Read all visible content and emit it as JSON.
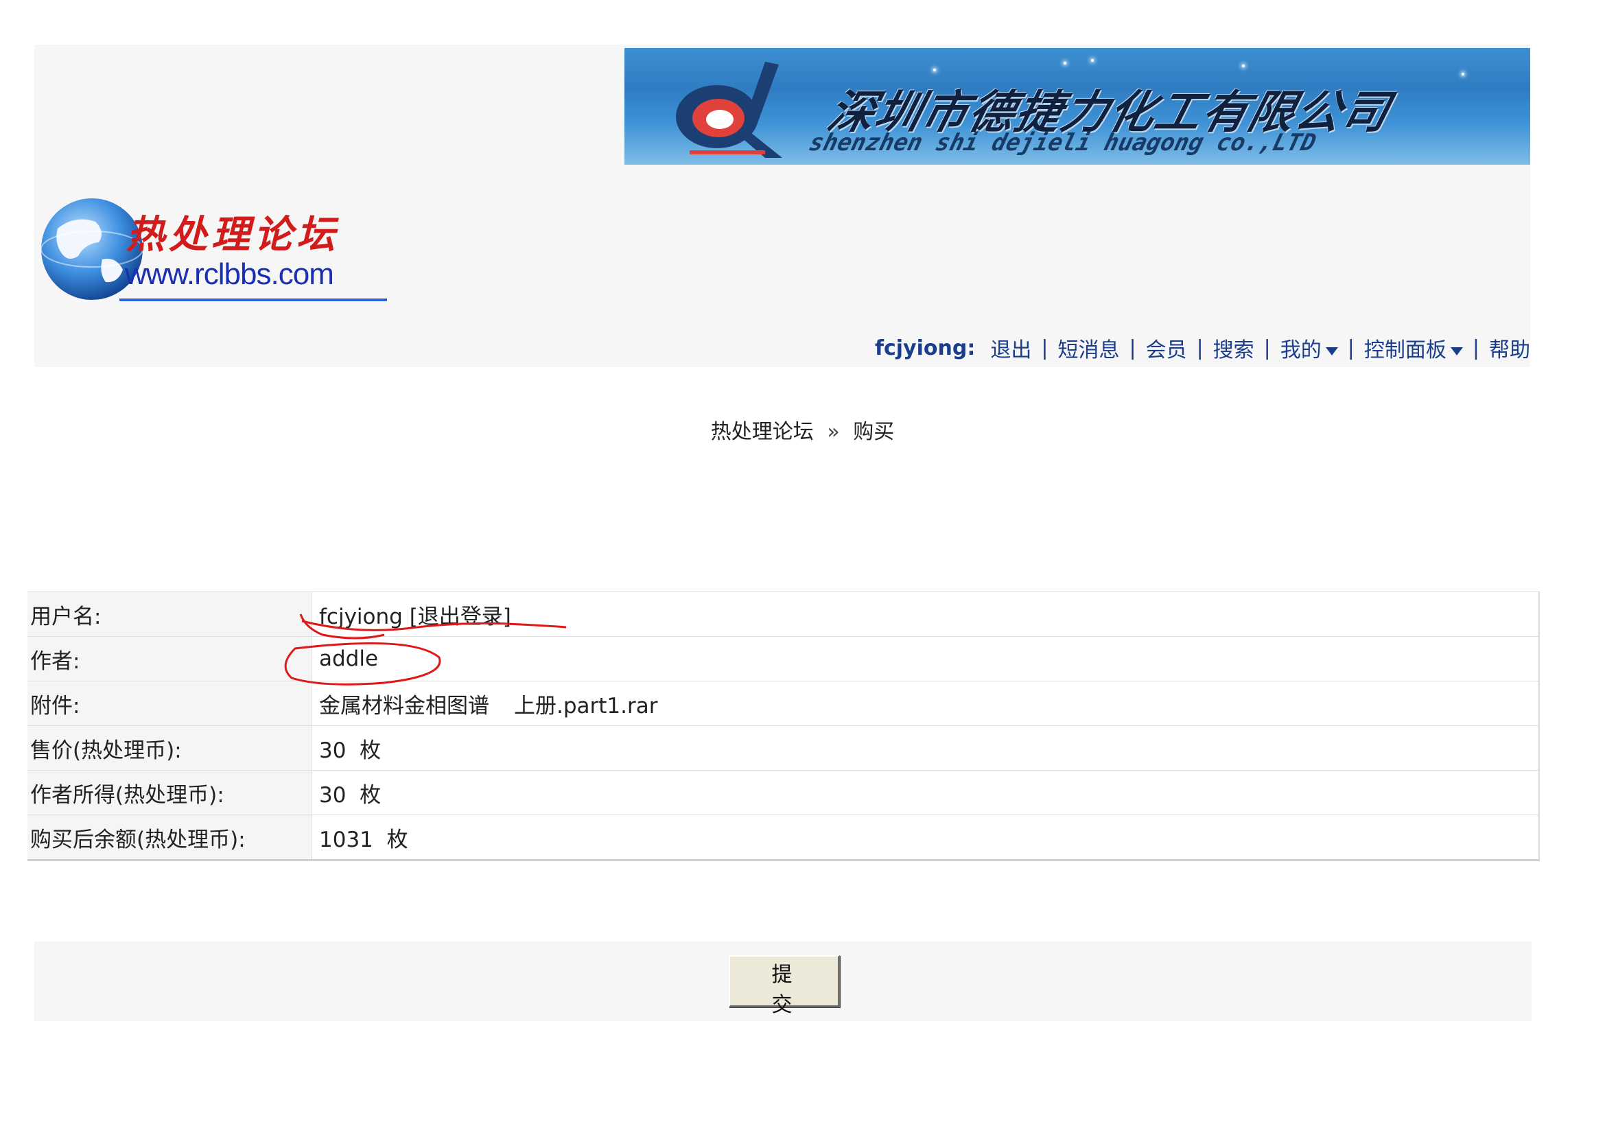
{
  "banner": {
    "company_name": "深圳市德捷力化工有限公司",
    "company_name_latin": "shenzhen shi dejieli huagong co.,LTD"
  },
  "forum_logo": {
    "name": "热处理论坛",
    "url": "www.rclbbs.com"
  },
  "usernav": {
    "username": "fcjyiong:",
    "items": [
      {
        "label": "退出"
      },
      {
        "label": "短消息"
      },
      {
        "label": "会员"
      },
      {
        "label": "搜索"
      },
      {
        "label": "我的",
        "dropdown": true
      },
      {
        "label": "控制面板",
        "dropdown": true
      },
      {
        "label": "帮助"
      }
    ],
    "separator": "|"
  },
  "breadcrumb": {
    "home": "热处理论坛",
    "separator": "»",
    "current": "购买"
  },
  "table": {
    "rows": [
      {
        "label": "用户名:",
        "value": "fcjyiong",
        "extra": "[退出登录]"
      },
      {
        "label": "作者:",
        "value": "addle"
      },
      {
        "label": "附件:",
        "value": "金属材料金相图谱",
        "extra": "上册.part1.rar"
      },
      {
        "label": "售价(热处理币):",
        "value": "30  枚"
      },
      {
        "label": "作者所得(热处理币):",
        "value": "30  枚"
      },
      {
        "label": "购买后余额(热处理币):",
        "value": "1031  枚"
      }
    ]
  },
  "submit": {
    "label": "提交"
  },
  "colors": {
    "link": "#1a3e8c",
    "annotation": "#e01818",
    "header_bg": "#f6f6f6"
  }
}
